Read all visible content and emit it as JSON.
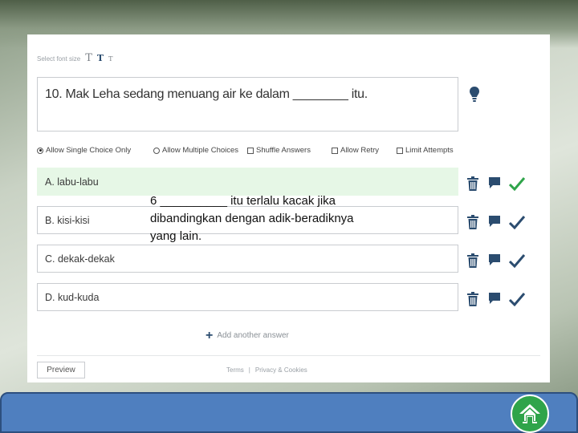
{
  "toolbar": {
    "font_size_label": "Select font size",
    "font_sizes": [
      "T",
      "T",
      "T"
    ]
  },
  "question": {
    "text": "10. Mak Leha sedang menuang air ke dalam ________ itu."
  },
  "options": {
    "single_choice": "Allow Single Choice Only",
    "multiple_choice": "Allow Multiple Choices",
    "shuffle": "Shuffle Answers",
    "retry": "Allow Retry",
    "limit": "Limit Attempts"
  },
  "answers": [
    {
      "label": "A.  labu-labu"
    },
    {
      "label": "B.  kisi-kisi"
    },
    {
      "label": "C.  dekak-dekak"
    },
    {
      "label": "D.  kud-kuda"
    }
  ],
  "add_answer_label": "Add another answer",
  "preview_label": "Preview",
  "footer": {
    "terms": "Terms",
    "separator": "|",
    "privacy": "Privacy & Cookies"
  },
  "overlay": {
    "line1": "6 __________ itu terlalu kacak jika",
    "line2": "dibandingkan dengan adik-beradiknya",
    "line3": "yang lain."
  },
  "colors": {
    "accent_blue": "#2b4c6f",
    "correct_green": "#2fa44a",
    "bar_blue": "#4f7fbf"
  }
}
